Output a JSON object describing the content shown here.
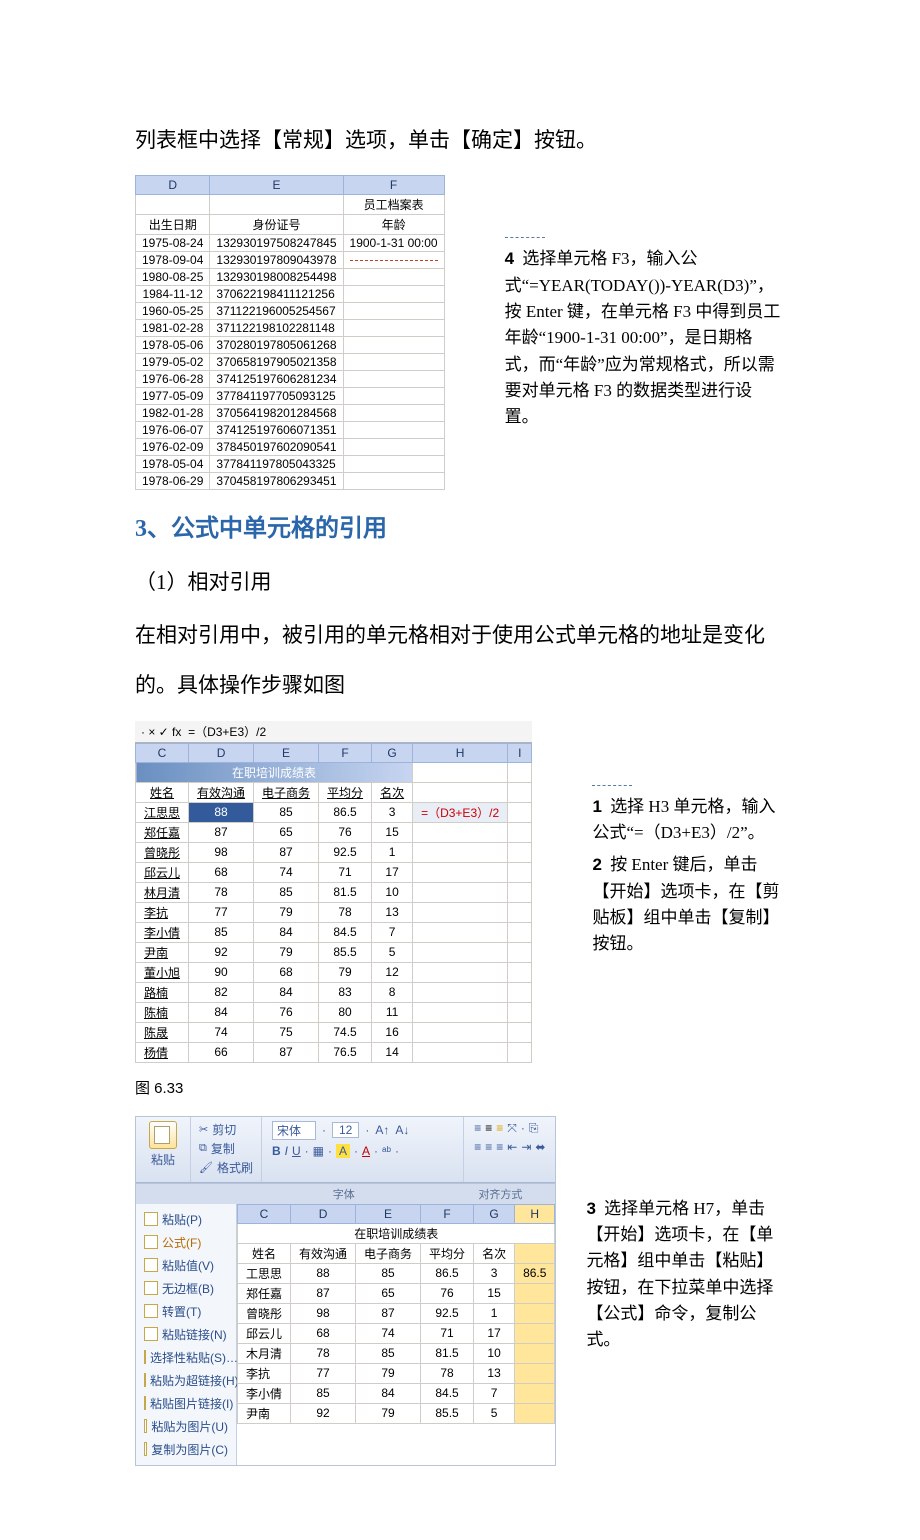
{
  "intro_line": "列表框中选择【常规】选项，单击【确定】按钮。",
  "table1": {
    "cols": [
      "D",
      "E",
      "F"
    ],
    "title": "员工档案表",
    "headers": [
      "出生日期",
      "身份证号",
      "年龄"
    ],
    "f3_value": "1900-1-31 00:00",
    "rows": [
      [
        "1975-08-24",
        "132930197508247845"
      ],
      [
        "1978-09-04",
        "132930197809043978"
      ],
      [
        "1980-08-25",
        "132930198008254498"
      ],
      [
        "1984-11-12",
        "370622198411121256"
      ],
      [
        "1960-05-25",
        "371122196005254567"
      ],
      [
        "1981-02-28",
        "371122198102281148"
      ],
      [
        "1978-05-06",
        "370280197805061268"
      ],
      [
        "1979-05-02",
        "370658197905021358"
      ],
      [
        "1976-06-28",
        "374125197606281234"
      ],
      [
        "1977-05-09",
        "377841197705093125"
      ],
      [
        "1982-01-28",
        "370564198201284568"
      ],
      [
        "1976-06-07",
        "374125197606071351"
      ],
      [
        "1976-02-09",
        "378450197602090541"
      ],
      [
        "1978-05-04",
        "377841197805043325"
      ],
      [
        "1978-06-29",
        "370458197806293451"
      ]
    ]
  },
  "step4_text": "选择单元格 F3，输入公式“=YEAR(TODAY())-YEAR(D3)”，按 Enter 键，在单元格 F3 中得到员工年龄“1900-1-31 00:00”，是日期格式，而“年龄”应为常规格式，所以需要对单元格 F3 的数据类型进行设置。",
  "heading3": "3、公式中单元格的引用",
  "sub1": "（1）相对引用",
  "para1": "在相对引用中，被引用的单元格相对于使用公式单元格的地址是变化的。具体操作步骤如图",
  "table2": {
    "formula_bar_prefix": "·  × ✓ fx",
    "formula": "=（D3+E3）/2",
    "cols": [
      "C",
      "D",
      "E",
      "F",
      "G",
      "H",
      "I"
    ],
    "title": "在职培训成绩表",
    "headers": [
      "姓名",
      "有效沟通",
      "电子商务",
      "平均分",
      "名次"
    ],
    "side_formula": "=（D3+E3）/2",
    "rows": [
      [
        "江思思",
        "88",
        "85",
        "86.5",
        "3"
      ],
      [
        "郑任嘉",
        "87",
        "65",
        "76",
        "15"
      ],
      [
        "曾晓彤",
        "98",
        "87",
        "92.5",
        "1"
      ],
      [
        "邱云儿",
        "68",
        "74",
        "71",
        "17"
      ],
      [
        "林月清",
        "78",
        "85",
        "81.5",
        "10"
      ],
      [
        "李抗",
        "77",
        "79",
        "78",
        "13"
      ],
      [
        "李小倩",
        "85",
        "84",
        "84.5",
        "7"
      ],
      [
        "尹南",
        "92",
        "79",
        "85.5",
        "5"
      ],
      [
        "董小旭",
        "90",
        "68",
        "79",
        "12"
      ],
      [
        "路楠",
        "82",
        "84",
        "83",
        "8"
      ],
      [
        "陈楠",
        "84",
        "76",
        "80",
        "11"
      ],
      [
        "陈晟",
        "74",
        "75",
        "74.5",
        "16"
      ],
      [
        "杨倩",
        "66",
        "87",
        "76.5",
        "14"
      ]
    ]
  },
  "caption633": "图 6.33",
  "step1_text": "选择 H3 单元格，输入公式“=（D3+E3）/2”。",
  "step2_text": "按 Enter 键后，单击【开始】选项卡，在【剪贴板】组中单击【复制】按钮。",
  "fig3": {
    "paste_label": "粘贴",
    "cut_label": "剪切",
    "copy_label": "复制",
    "fmtpainter_label": "格式刷",
    "font_name": "宋体",
    "font_size": "12",
    "group_font": "字体",
    "group_align": "对齐方式",
    "menu_items": [
      {
        "label": "粘贴(P)"
      },
      {
        "label": "公式(F)",
        "hi": true
      },
      {
        "label": "粘贴值(V)"
      },
      {
        "label": "无边框(B)"
      },
      {
        "label": "转置(T)"
      },
      {
        "label": "粘贴链接(N)"
      },
      {
        "label": "选择性粘贴(S)…"
      },
      {
        "label": "粘贴为超链接(H)"
      },
      {
        "label": "粘贴图片链接(I)"
      },
      {
        "label": "粘贴为图片(U)"
      },
      {
        "label": "复制为图片(C)"
      }
    ],
    "sheet": {
      "cols": [
        "C",
        "D",
        "E",
        "F",
        "G",
        "H"
      ],
      "title": "在职培训成绩表",
      "headers": [
        "姓名",
        "有效沟通",
        "电子商务",
        "平均分",
        "名次",
        ""
      ],
      "h_value": "86.5",
      "rows": [
        [
          "工思思",
          "88",
          "85",
          "86.5",
          "3"
        ],
        [
          "郑任嘉",
          "87",
          "65",
          "76",
          "15"
        ],
        [
          "曾晓彤",
          "98",
          "87",
          "92.5",
          "1"
        ],
        [
          "邱云儿",
          "68",
          "74",
          "71",
          "17"
        ],
        [
          "木月清",
          "78",
          "85",
          "81.5",
          "10"
        ],
        [
          "李抗",
          "77",
          "79",
          "78",
          "13"
        ],
        [
          "李小倩",
          "85",
          "84",
          "84.5",
          "7"
        ],
        [
          "尹南",
          "92",
          "79",
          "85.5",
          "5"
        ]
      ]
    }
  },
  "step3_text": "选择单元格 H7，单击【开始】选项卡，在【单元格】组中单击【粘贴】按钮，在下拉菜单中选择【公式】命令，复制公式。",
  "num4": "4",
  "num1": "1",
  "num2": "2",
  "num3": "3"
}
